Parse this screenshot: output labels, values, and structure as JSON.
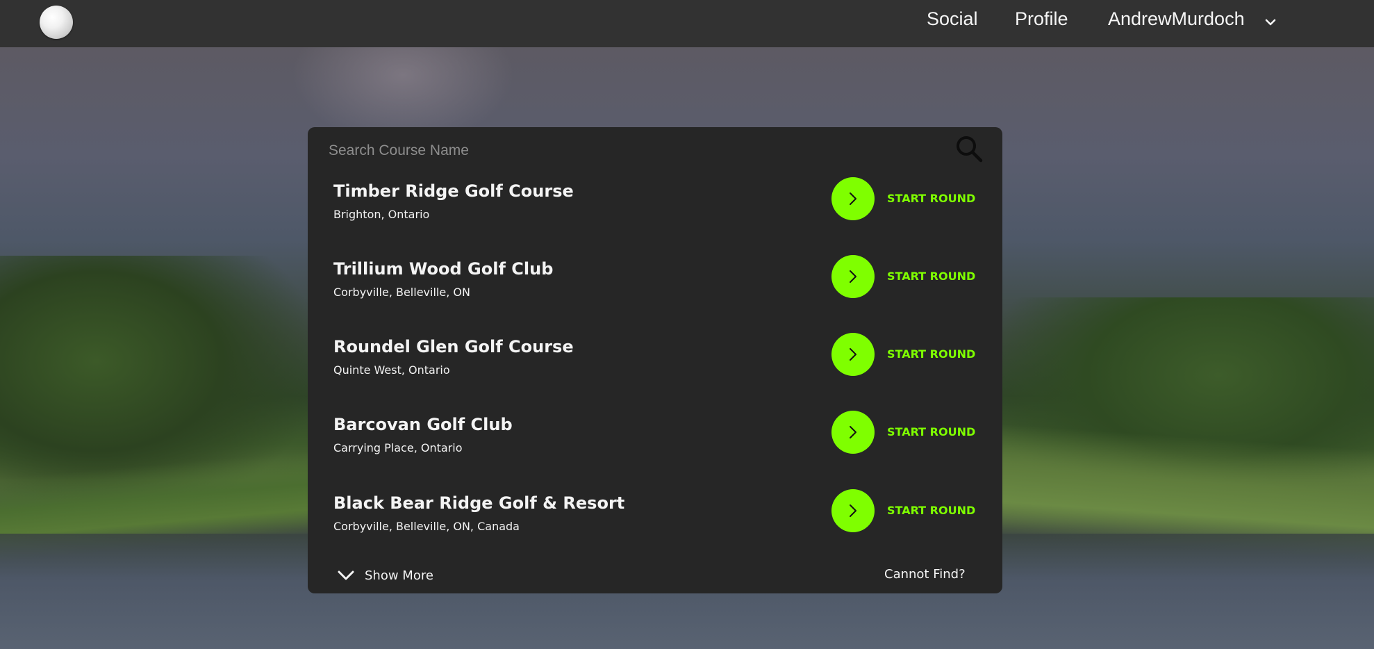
{
  "nav": {
    "social_label": "Social",
    "profile_label": "Profile",
    "user_name": "AndrewMurdoch",
    "logo_icon": "golf-ball-icon",
    "user_menu_icon": "chevron-down-icon"
  },
  "search": {
    "placeholder": "Search Course Name",
    "value": "",
    "icon": "search-icon"
  },
  "courses": [
    {
      "name": "Timber Ridge Golf Course",
      "location": "Brighton, Ontario",
      "action_label": "START ROUND"
    },
    {
      "name": "Trillium Wood Golf Club",
      "location": "Corbyville, Belleville, ON",
      "action_label": "START ROUND"
    },
    {
      "name": "Roundel Glen Golf Course",
      "location": "Quinte West, Ontario",
      "action_label": "START ROUND"
    },
    {
      "name": "Barcovan Golf Club",
      "location": "Carrying Place, Ontario",
      "action_label": "START ROUND"
    },
    {
      "name": "Black Bear Ridge Golf & Resort",
      "location": "Corbyville, Belleville, ON, Canada",
      "action_label": "START ROUND"
    }
  ],
  "footer": {
    "show_more_label": "Show More",
    "cannot_find_label": "Cannot Find?"
  },
  "colors": {
    "accent": "#7fff00",
    "navbar": "#323232",
    "panel": "#262626"
  }
}
